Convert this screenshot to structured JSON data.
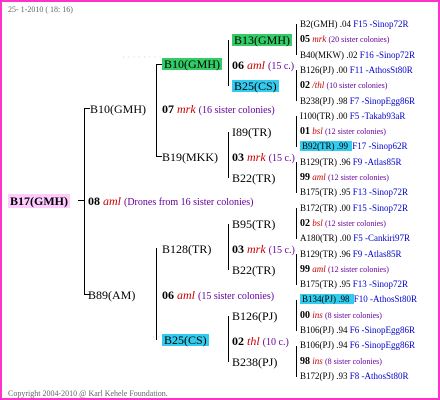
{
  "header": "25- 1-2010 ( 18: 16)",
  "footer": "Copyright 2004-2010 @ Karl Kehele Foundation.",
  "root": {
    "label": "B17(GMH)",
    "gen": "08",
    "mark": "aml",
    "note": "(Drones from 16 sister colonies)"
  },
  "b10": {
    "label": "B10(GMH)",
    "gen": "07",
    "mark": "mrk",
    "note": "(16 sister colonies)"
  },
  "b89": {
    "label": "B89(AM)",
    "gen": "06",
    "mark": "aml",
    "note": "(15 sister colonies)"
  },
  "b10b": {
    "label": "B10(GMH)",
    "gen": "06",
    "mark": "aml",
    "note": "(15 c.)"
  },
  "b19": {
    "label": "B19(MKK)",
    "gen": "03",
    "mark": "mrk",
    "note": "(15 c.)"
  },
  "b128": {
    "label": "B128(TR)",
    "gen": "03",
    "mark": "mrk",
    "note": "(15 c.)"
  },
  "b25": {
    "label": "B25(CS)",
    "gen": "02",
    "mark": "thl",
    "note": "(10 c.)"
  },
  "b13": {
    "label": "B13(GMH)"
  },
  "b25cs": {
    "label": "B25(CS)"
  },
  "i89": {
    "label": "I89(TR)"
  },
  "b22a": {
    "label": "B22(TR)"
  },
  "b95": {
    "label": "B95(TR)"
  },
  "b22b": {
    "label": "B22(TR)"
  },
  "b126": {
    "label": "B126(PJ)"
  },
  "b238": {
    "label": "B238(PJ)"
  },
  "rows": [
    {
      "a": "B2(GMH) .04",
      "b": "F15 -Sinop72R"
    },
    {
      "a": "05",
      "m": "mrk",
      "n": "(20 sister colonies)"
    },
    {
      "a": "B40(MKW) .02",
      "b": "F16 -Sinop72R"
    },
    {
      "a": "B126(PJ) .00",
      "b": "F11 -AthosSt80R"
    },
    {
      "a": "02",
      "m": "/thl",
      "n": "(10 sister colonies)"
    },
    {
      "a": "B238(PJ) .98",
      "b": "F7 -SinopEgg86R"
    },
    {
      "a": "I100(TR) .00",
      "b": "F5 -Takab93aR"
    },
    {
      "a": "01",
      "m": "bsl",
      "n": "(12 sister colonies)"
    },
    {
      "a": "B92(TR) .99",
      "b": "F17 -Sinop62R"
    },
    {
      "a": "B129(TR) .96",
      "b": "F9 -Atlas85R"
    },
    {
      "a": "99",
      "m": "aml",
      "n": "(12 sister colonies)"
    },
    {
      "a": "B175(TR) .95",
      "b": "F13 -Sinop72R"
    },
    {
      "a": "B172(TR) .00",
      "b": "F15 -Sinop72R"
    },
    {
      "a": "02",
      "m": "bsl",
      "n": "(12 sister colonies)"
    },
    {
      "a": "A180(TR) .00",
      "b": "F5 -Cankiri97R"
    },
    {
      "a": "B129(TR) .96",
      "b": "F9 -Atlas85R"
    },
    {
      "a": "99",
      "m": "aml",
      "n": "(12 sister colonies)"
    },
    {
      "a": "B175(TR) .95",
      "b": "F13 -Sinop72R"
    },
    {
      "a": "B134(PJ) .98",
      "b": "F10 -AthosSt80R"
    },
    {
      "a": "00",
      "m": "ins",
      "n": "(8 sister colonies)"
    },
    {
      "a": "B106(PJ) .94",
      "b": "F6 -SinopEgg86R"
    },
    {
      "a": "B106(PJ) .94",
      "b": "F6 -SinopEgg86R"
    },
    {
      "a": "98",
      "m": "ins",
      "n": "(8 sister colonies)"
    },
    {
      "a": "B172(PJ) .93",
      "b": "F8 -AthosSt80R"
    }
  ]
}
